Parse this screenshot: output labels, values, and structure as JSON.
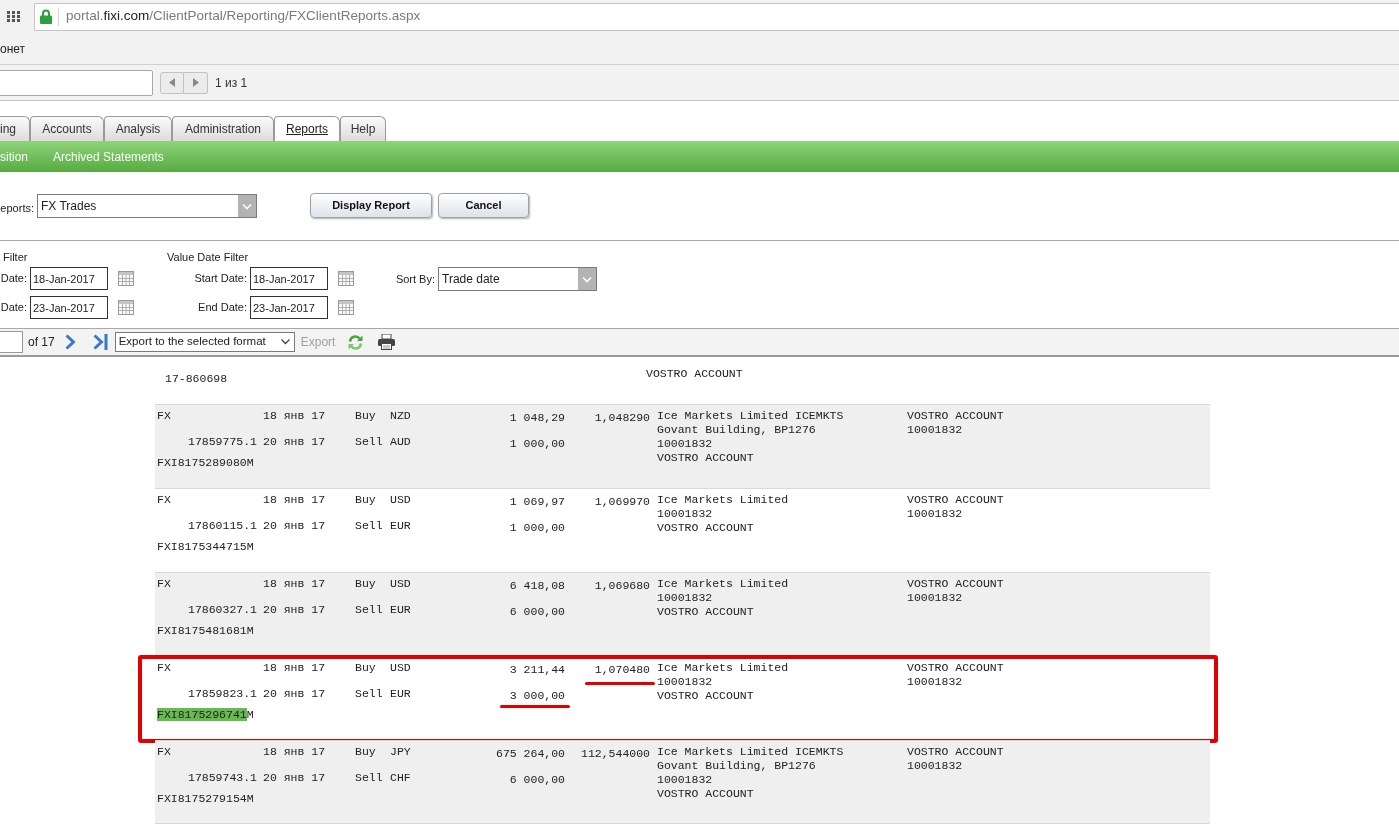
{
  "browser": {
    "url": {
      "prefix": "portal.",
      "domain": "fixi.com",
      "path": "/ClientPortal/Reporting/FXClientReports.aspx"
    },
    "bookmark": "онет"
  },
  "find_bar": {
    "match_count": "1 из 1"
  },
  "tabs": [
    {
      "label": "ing",
      "selected": false
    },
    {
      "label": "Accounts",
      "selected": false
    },
    {
      "label": "Analysis",
      "selected": false
    },
    {
      "label": "Administration",
      "selected": false
    },
    {
      "label": "Reports",
      "selected": true
    },
    {
      "label": "Help",
      "selected": false
    }
  ],
  "subnav": [
    {
      "label": "sition"
    },
    {
      "label": "Archived Statements"
    }
  ],
  "report_picker": {
    "label": "eports:",
    "value": "FX Trades",
    "buttons": [
      "Display Report",
      "Cancel"
    ]
  },
  "filters": [
    {
      "title": "Filter",
      "fields": [
        {
          "label": "Date:",
          "value": "18-Jan-2017"
        },
        {
          "label": "Date:",
          "value": "23-Jan-2017"
        }
      ]
    },
    {
      "title": "Value Date Filter",
      "fields": [
        {
          "label": "Start Date:",
          "value": "18-Jan-2017"
        },
        {
          "label": "End Date:",
          "value": "23-Jan-2017"
        }
      ]
    }
  ],
  "sort": {
    "label": "Sort By:",
    "value": "Trade date"
  },
  "toolbar": {
    "page_total": "of 17",
    "export_format": "Export to the selected format",
    "export": {
      "label": "Export",
      "disabled": true
    }
  },
  "report": {
    "partial_row": {
      "reference": "17-860698",
      "counterparty": [
        "VOSTRO ACCOUNT"
      ]
    },
    "trades": [
      {
        "type": "FX",
        "ref": "17859775.1",
        "ext_ref": [
          {
            "text": "FXI8175289080M",
            "highlighted": false
          }
        ],
        "trade_date": "18 янв 17",
        "value_date": "20 янв 17",
        "buy": {
          "side": "Buy",
          "currency": "NZD",
          "amount": "1 048,29",
          "underlined": false
        },
        "sell": {
          "side": "Sell",
          "currency": "AUD",
          "amount": "1 000,00",
          "underlined": false
        },
        "rate": "1,048290",
        "rate_underlined": false,
        "counterparty": [
          "Ice Markets Limited ICEMKTS",
          "Govant Building, BP1276",
          "10001832",
          "VOSTRO ACCOUNT"
        ],
        "account": [
          "VOSTRO ACCOUNT",
          "10001832"
        ],
        "shaded": true,
        "boxed": false
      },
      {
        "type": "FX",
        "ref": "17860115.1",
        "ext_ref": [
          {
            "text": "FXI8175344715M",
            "highlighted": false
          }
        ],
        "trade_date": "18 янв 17",
        "value_date": "20 янв 17",
        "buy": {
          "side": "Buy",
          "currency": "USD",
          "amount": "1 069,97",
          "underlined": false
        },
        "sell": {
          "side": "Sell",
          "currency": "EUR",
          "amount": "1 000,00",
          "underlined": false
        },
        "rate": "1,069970",
        "rate_underlined": false,
        "counterparty": [
          "Ice Markets Limited",
          "10001832",
          "VOSTRO ACCOUNT"
        ],
        "account": [
          "VOSTRO ACCOUNT",
          "10001832"
        ],
        "shaded": false,
        "boxed": false
      },
      {
        "type": "FX",
        "ref": "17860327.1",
        "ext_ref": [
          {
            "text": "FXI8175481681M",
            "highlighted": false
          }
        ],
        "trade_date": "18 янв 17",
        "value_date": "20 янв 17",
        "buy": {
          "side": "Buy",
          "currency": "USD",
          "amount": "6 418,08",
          "underlined": false
        },
        "sell": {
          "side": "Sell",
          "currency": "EUR",
          "amount": "6 000,00",
          "underlined": false
        },
        "rate": "1,069680",
        "rate_underlined": false,
        "counterparty": [
          "Ice Markets Limited",
          "10001832",
          "VOSTRO ACCOUNT"
        ],
        "account": [
          "VOSTRO ACCOUNT",
          "10001832"
        ],
        "shaded": true,
        "boxed": false
      },
      {
        "type": "FX",
        "ref": "17859823.1",
        "ext_ref": [
          {
            "text": "FXI8175296741",
            "highlighted": true
          },
          {
            "text": "M",
            "highlighted": false
          }
        ],
        "trade_date": "18 янв 17",
        "value_date": "20 янв 17",
        "buy": {
          "side": "Buy",
          "currency": "USD",
          "amount": "3 211,44",
          "underlined": false
        },
        "sell": {
          "side": "Sell",
          "currency": "EUR",
          "amount": "3 000,00",
          "underlined": true
        },
        "rate": "1,070480",
        "rate_underlined": true,
        "counterparty": [
          "Ice Markets Limited",
          "10001832",
          "VOSTRO ACCOUNT"
        ],
        "account": [
          "VOSTRO ACCOUNT",
          "10001832"
        ],
        "shaded": false,
        "boxed": true
      },
      {
        "type": "FX",
        "ref": "17859743.1",
        "ext_ref": [
          {
            "text": "FXI8175279154M",
            "highlighted": false
          }
        ],
        "trade_date": "18 янв 17",
        "value_date": "20 янв 17",
        "buy": {
          "side": "Buy",
          "currency": "JPY",
          "amount": "675 264,00",
          "underlined": false
        },
        "sell": {
          "side": "Sell",
          "currency": "CHF",
          "amount": "6 000,00",
          "underlined": false
        },
        "rate": "112,544000",
        "rate_underlined": false,
        "counterparty": [
          "Ice Markets Limited ICEMKTS",
          "Govant Building, BP1276",
          "10001832",
          "VOSTRO ACCOUNT"
        ],
        "account": [
          "VOSTRO ACCOUNT",
          "10001832"
        ],
        "shaded": true,
        "boxed": false
      }
    ]
  }
}
